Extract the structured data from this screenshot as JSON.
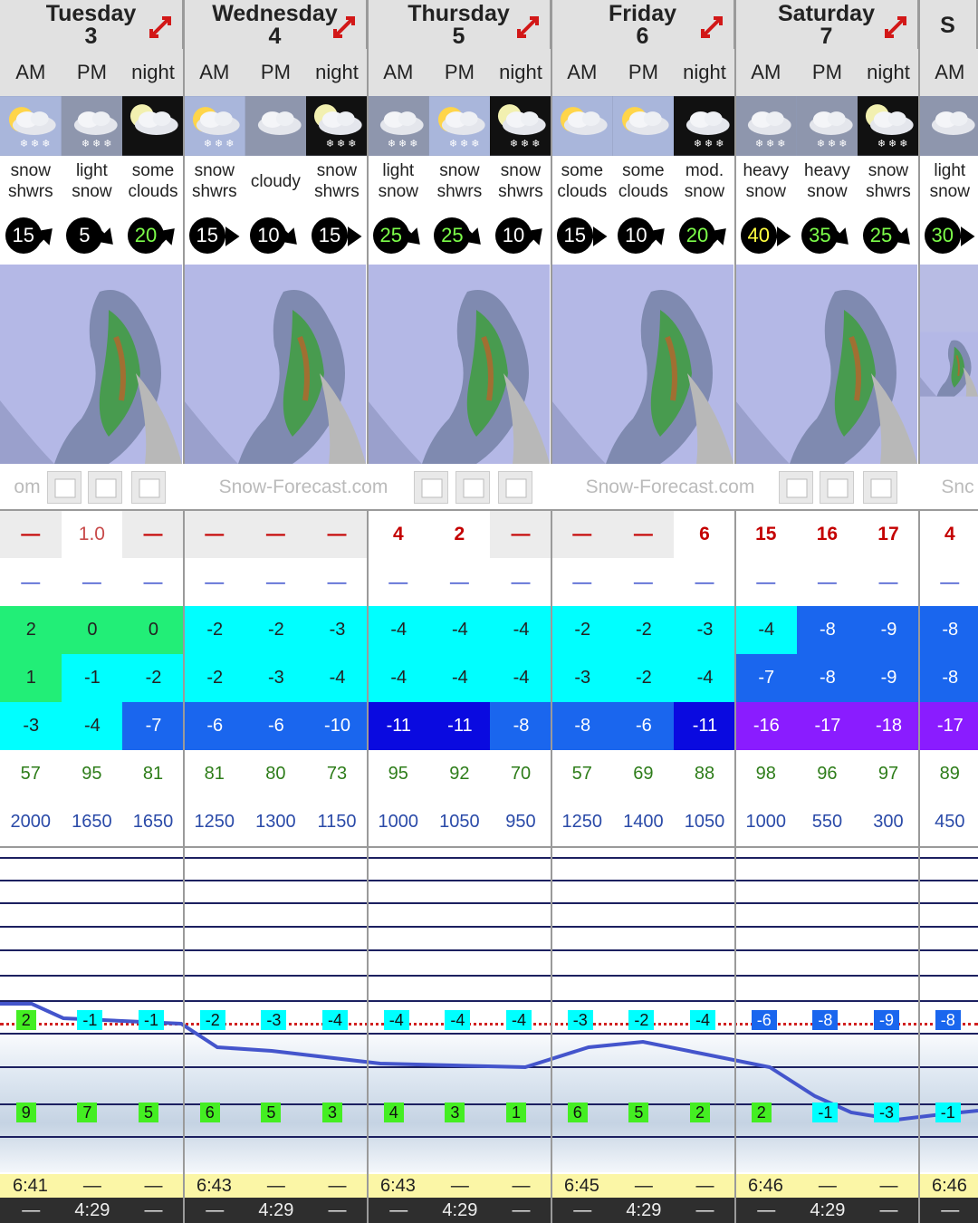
{
  "days": [
    {
      "name": "Tuesday",
      "num": "3"
    },
    {
      "name": "Wednesday",
      "num": "4"
    },
    {
      "name": "Thursday",
      "num": "5"
    },
    {
      "name": "Friday",
      "num": "6"
    },
    {
      "name": "Saturday",
      "num": "7"
    },
    {
      "name": "S",
      "num": ""
    }
  ],
  "periods": [
    "AM",
    "PM",
    "night",
    "AM",
    "PM",
    "night",
    "AM",
    "PM",
    "night",
    "AM",
    "PM",
    "night",
    "AM",
    "PM",
    "night",
    "AM"
  ],
  "icons": [
    "sun-cloud-snow",
    "cloud-snow",
    "moon-cloud",
    "sun-cloud-snow",
    "cloud",
    "moon-cloud-snow",
    "cloud-snow",
    "sun-cloud-snow",
    "moon-cloud-snow",
    "sun-cloud",
    "sun-cloud",
    "cloud-snow-night",
    "cloud-snow",
    "cloud-snow",
    "moon-cloud-snow",
    "cloud"
  ],
  "weather": [
    [
      "snow",
      "shwrs"
    ],
    [
      "light",
      "snow"
    ],
    [
      "some",
      "clouds"
    ],
    [
      "snow",
      "shwrs"
    ],
    [
      "cloudy",
      ""
    ],
    [
      "snow",
      "shwrs"
    ],
    [
      "light",
      "snow"
    ],
    [
      "snow",
      "shwrs"
    ],
    [
      "snow",
      "shwrs"
    ],
    [
      "some",
      "clouds"
    ],
    [
      "some",
      "clouds"
    ],
    [
      "mod.",
      "snow"
    ],
    [
      "heavy",
      "snow"
    ],
    [
      "heavy",
      "snow"
    ],
    [
      "snow",
      "shwrs"
    ],
    [
      "light",
      "snow"
    ]
  ],
  "wind": [
    {
      "v": "15",
      "c": "#ffffff",
      "dir": "ne"
    },
    {
      "v": "5",
      "c": "#ffffff",
      "dir": "se"
    },
    {
      "v": "20",
      "c": "#7dff4a",
      "dir": "ne"
    },
    {
      "v": "15",
      "c": "#ffffff",
      "dir": "e"
    },
    {
      "v": "10",
      "c": "#ffffff",
      "dir": "se"
    },
    {
      "v": "15",
      "c": "#ffffff",
      "dir": "e"
    },
    {
      "v": "25",
      "c": "#7dff4a",
      "dir": "se"
    },
    {
      "v": "25",
      "c": "#7dff4a",
      "dir": "se"
    },
    {
      "v": "10",
      "c": "#ffffff",
      "dir": "ne"
    },
    {
      "v": "15",
      "c": "#ffffff",
      "dir": "e"
    },
    {
      "v": "10",
      "c": "#ffffff",
      "dir": "ne"
    },
    {
      "v": "20",
      "c": "#7dff4a",
      "dir": "ne"
    },
    {
      "v": "40",
      "c": "#ffff40",
      "dir": "e"
    },
    {
      "v": "35",
      "c": "#7dff4a",
      "dir": "se"
    },
    {
      "v": "25",
      "c": "#7dff4a",
      "dir": "se"
    },
    {
      "v": "30",
      "c": "#7dff4a",
      "dir": "e"
    }
  ],
  "credit": [
    "om",
    "Snow-Forecast.com",
    "Snow-Forecast.com",
    "Snc"
  ],
  "snow": [
    "—",
    "1.0",
    "—",
    "—",
    "—",
    "—",
    "4",
    "2",
    "—",
    "—",
    "—",
    "6",
    "15",
    "16",
    "17",
    "4"
  ],
  "rain": [
    "—",
    "—",
    "—",
    "—",
    "—",
    "—",
    "—",
    "—",
    "—",
    "—",
    "—",
    "—",
    "—",
    "—",
    "—",
    "—"
  ],
  "temp_max": [
    "2",
    "0",
    "0",
    "-2",
    "-2",
    "-3",
    "-4",
    "-4",
    "-4",
    "-2",
    "-2",
    "-3",
    "-4",
    "-8",
    "-9",
    "-8"
  ],
  "temp_min": [
    "1",
    "-1",
    "-2",
    "-2",
    "-3",
    "-4",
    "-4",
    "-4",
    "-4",
    "-3",
    "-2",
    "-4",
    "-7",
    "-8",
    "-9",
    "-8"
  ],
  "temp_chill": [
    "-3",
    "-4",
    "-7",
    "-6",
    "-6",
    "-10",
    "-11",
    "-11",
    "-8",
    "-8",
    "-6",
    "-11",
    "-16",
    "-17",
    "-18",
    "-17"
  ],
  "humidity": [
    "57",
    "95",
    "81",
    "81",
    "80",
    "73",
    "95",
    "92",
    "70",
    "57",
    "69",
    "88",
    "98",
    "96",
    "97",
    "89"
  ],
  "freezing": [
    "2000",
    "1650",
    "1650",
    "1250",
    "1300",
    "1150",
    "1000",
    "1050",
    "950",
    "1250",
    "1400",
    "1050",
    "1000",
    "550",
    "300",
    "450"
  ],
  "graph_upper": [
    "2",
    "-1",
    "-1",
    "-2",
    "-3",
    "-4",
    "-4",
    "-4",
    "-4",
    "-3",
    "-2",
    "-4",
    "-6",
    "-8",
    "-9",
    "-8"
  ],
  "graph_lower": [
    "9",
    "7",
    "5",
    "6",
    "5",
    "3",
    "4",
    "3",
    "1",
    "6",
    "5",
    "2",
    "2",
    "-1",
    "-3",
    "-1"
  ],
  "sunrise": [
    "6:41",
    "—",
    "—",
    "6:43",
    "—",
    "—",
    "6:43",
    "—",
    "—",
    "6:45",
    "—",
    "—",
    "6:46",
    "—",
    "—",
    "6:46"
  ],
  "sunset": [
    "—",
    "4:29",
    "—",
    "—",
    "4:29",
    "—",
    "—",
    "4:29",
    "—",
    "—",
    "4:29",
    "—",
    "—",
    "4:29",
    "—",
    "—"
  ],
  "colors": {
    "green_cell": "#22ee77",
    "cyan_cell": "#00ffff",
    "blue_cell": "#1a66ee",
    "navy_cell": "#0a0ae0",
    "purple_cell": "#8a1cff",
    "sun_bar": "#fbf6a6",
    "sunset_bar": "#2e2e2e",
    "accent_red": "#c40000"
  }
}
